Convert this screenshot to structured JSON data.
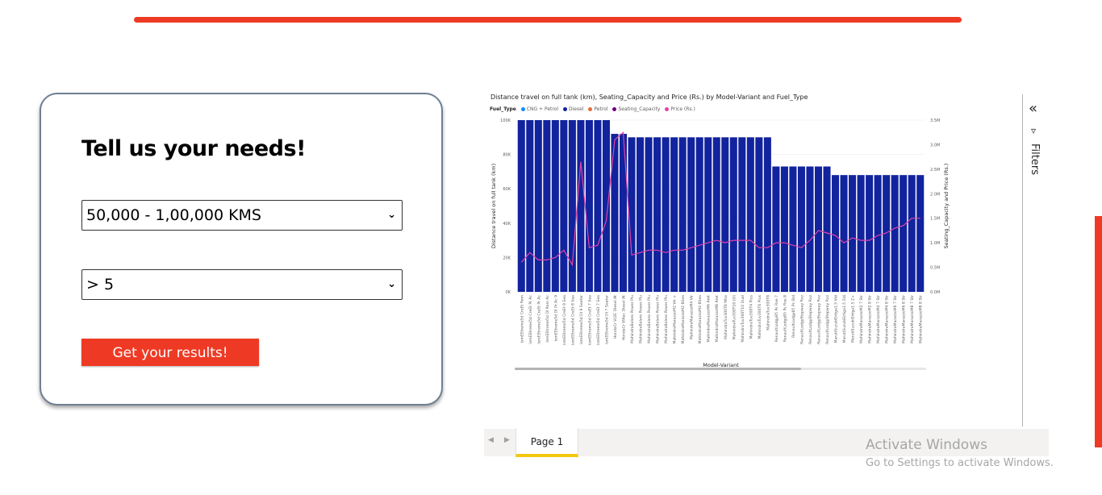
{
  "header": {
    "accent_color": "#ee3a24"
  },
  "form": {
    "title": "Tell us your needs!",
    "distance_select": {
      "value": "50,000 - 1,00,000 KMS"
    },
    "seating_select": {
      "value": "> 5"
    },
    "submit_label": "Get your results!"
  },
  "report": {
    "filters_label": "Filters",
    "page_tab": "Page 1"
  },
  "chart_data": {
    "type": "bar",
    "title": "Distance travel on full tank (km), Seating_Capacity and Price (Rs.) by Model-Variant and Fuel_Type",
    "legend_title": "Fuel_Type",
    "legend": [
      {
        "name": "CNG + Petrol",
        "color": "#118dff"
      },
      {
        "name": "Diesel",
        "color": "#12239e"
      },
      {
        "name": "Petrol",
        "color": "#e66c37"
      },
      {
        "name": "Seating_Capacity",
        "color": "#6b007b"
      },
      {
        "name": "Price (Rs.)",
        "color": "#e044a7"
      }
    ],
    "xlabel": "Model-Variant",
    "ylabel": "Distance travel on full tank (km)",
    "y2label": "Seating_Capacity and Price (Rs.)",
    "y_ticks": [
      "100K",
      "80K",
      "60K",
      "40K",
      "20K",
      "0K"
    ],
    "y2_ticks": [
      "3.5M",
      "3.0M",
      "2.5M",
      "2.0M",
      "1.5M",
      "1.0M",
      "0.5M",
      "0.0M"
    ],
    "ylim": [
      0,
      100000
    ],
    "y2lim": [
      0,
      3500000
    ],
    "categories": [
      "ismEEtreme5d CreEt Rom",
      "ismEEtreme5d CreEt Pr Ac",
      "ismEEtreme5d CreEt Pr Ac",
      "ismEEtreme5d DI Rom Ac",
      "ismEEtreme5d DI Pr Ac 9",
      "ismEEtreme5d CreEt 9 Sea",
      "ismEEtreme5d CreEt 8 Sea",
      "ismEEtreme5d DI 9 Seater",
      "ismEEtreme5d CreEt 7 Sea",
      "ismEEtreme5d CreEt 7 Sea",
      "ismEEtreme5d DI 7 Seater",
      "HondaCr V(2E Diesel At",
      "HondaCr VIAec Diesel At",
      "MahindraBolero Power Plu",
      "MahindraBolero Power Plu",
      "MahindraBolero Power Plu",
      "MahindraBolero Power Plu",
      "MahindraBolero Power Plu",
      "MahindraMarazzoM2 Vir +",
      "MahindraMarazzoM2 8Sea",
      "MahindraMarazzoM4 Vir",
      "MahindraMarazzoM4 8Sea",
      "MahindraMarazzoM6 Amt",
      "MahindraMarazzoM8 Amt",
      "MahindraTuv300T8 Mha",
      "MahindraTuv300T10 (O)",
      "MahindraTuv300T10 Dual",
      "MahindraTuv300T4 Plus",
      "MahindraTuv300T6 Plus",
      "MahindraTuv300T8",
      "RenaultLodgy85 Ps Rxe 7",
      "RenaultLodgy85 Ps Rxe 8",
      "RenaultLodgy85 Ps Std",
      "RenaultLodgyStepway Rxz",
      "RenaultLodgyStepway Rxz",
      "RenaultLodgyStepway Rxz",
      "RenaultLodgyStepway Rxz",
      "MarutiSuzukiErtiga1.5 Vdi",
      "MarutiSuzukiErtiga1.5 Zdi",
      "MarutiSuzukiErtiga1.5 Z+",
      "MahindraMarazzoM2 7 Str",
      "MahindraMarazzoM2 8 Str",
      "MahindraMarazzoM4 7 Str",
      "MahindraMarazzoM4 8 Str",
      "MahindraMarazzoM6 7 Str",
      "MahindraMarazzoM6 8 Str",
      "MahindraMarazzoM8 7 Str",
      "MahindraMarazzoM8 8 Str"
    ],
    "series": [
      {
        "name": "Diesel",
        "values": [
          100000,
          100000,
          100000,
          100000,
          100000,
          100000,
          100000,
          100000,
          100000,
          100000,
          100000,
          92000,
          92000,
          90000,
          90000,
          90000,
          90000,
          90000,
          90000,
          90000,
          90000,
          90000,
          90000,
          90000,
          90000,
          90000,
          90000,
          90000,
          90000,
          90000,
          73000,
          73000,
          73000,
          73000,
          73000,
          73000,
          73000,
          68000,
          68000,
          68000,
          68000,
          68000,
          68000,
          68000,
          68000,
          68000,
          68000,
          68000
        ]
      },
      {
        "name": "Price (Rs.)",
        "values": [
          600000,
          800000,
          650000,
          650000,
          700000,
          850000,
          550000,
          2650000,
          900000,
          950000,
          1450000,
          3100000,
          3250000,
          750000,
          800000,
          850000,
          850000,
          800000,
          850000,
          850000,
          900000,
          950000,
          1000000,
          1050000,
          1000000,
          1050000,
          1050000,
          1050000,
          900000,
          900000,
          1000000,
          1000000,
          950000,
          900000,
          1050000,
          1250000,
          1200000,
          1150000,
          1000000,
          1100000,
          1050000,
          1050000,
          1150000,
          1200000,
          1300000,
          1350000,
          1500000,
          1500000
        ]
      }
    ]
  },
  "watermark": {
    "title": "Activate Windows",
    "subtitle": "Go to Settings to activate Windows."
  }
}
